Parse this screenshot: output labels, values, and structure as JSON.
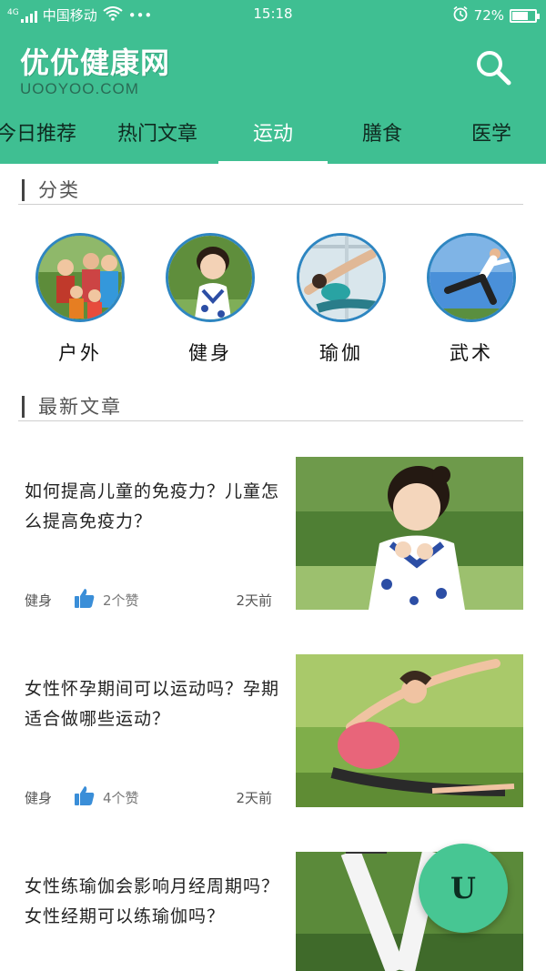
{
  "status_bar": {
    "carrier": "中国移动",
    "network": "4G",
    "more": "•••",
    "time": "15:18",
    "battery": "72%",
    "battery_level": 0.72,
    "icons": [
      "signal-icon",
      "wifi-icon",
      "alarm-icon",
      "battery-icon"
    ]
  },
  "header": {
    "title": "优优健康网",
    "subtitle": "UOOYOO.COM",
    "search_icon": "search-icon",
    "accent_color": "#3fbf92"
  },
  "tabs": [
    {
      "label": "今日推荐",
      "active": false
    },
    {
      "label": "热门文章",
      "active": false
    },
    {
      "label": "运动",
      "active": true
    },
    {
      "label": "膳食",
      "active": false
    },
    {
      "label": "医学",
      "active": false
    }
  ],
  "categories_section": {
    "heading": "分类",
    "items": [
      {
        "label": "户外",
        "image": "family-outdoor-photo"
      },
      {
        "label": "健身",
        "image": "girl-photo"
      },
      {
        "label": "瑜伽",
        "image": "yoga-photo"
      },
      {
        "label": "武术",
        "image": "martial-arts-photo"
      }
    ]
  },
  "articles_section": {
    "heading": "最新文章",
    "items": [
      {
        "title": "如何提高儿童的免疫力？儿童怎么提高免疫力？",
        "tag": "健身",
        "likes": "2个赞",
        "time": "2天前",
        "image": "girl-photo"
      },
      {
        "title": "女性怀孕期间可以运动吗？孕期适合做哪些运动？",
        "tag": "健身",
        "likes": "4个赞",
        "time": "2天前",
        "image": "pregnant-yoga-photo"
      },
      {
        "title": "女性练瑜伽会影响月经周期吗？女性经期可以练瑜伽吗？",
        "tag": "",
        "likes": "",
        "time": "",
        "image": "yoga-bend-photo"
      }
    ]
  },
  "fab": {
    "label": "U"
  }
}
